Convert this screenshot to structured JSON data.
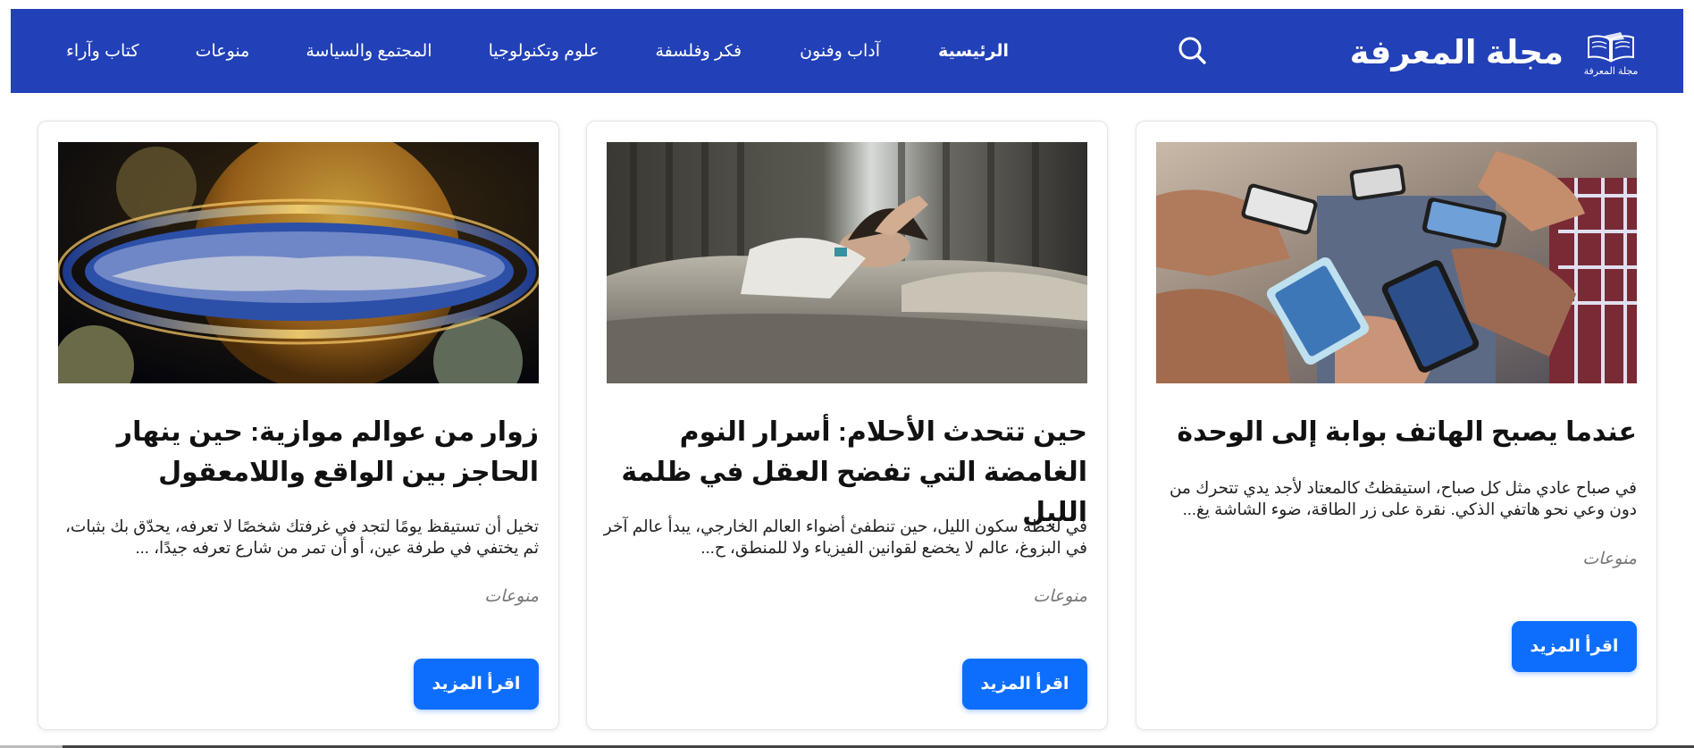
{
  "header": {
    "brand_name": "مجلة المعرفة",
    "logo_caption": "مجلة المعرفة",
    "bg_color": "#2240b7",
    "search_icon": "search-icon",
    "nav": [
      {
        "label": "الرئيسية",
        "active": true
      },
      {
        "label": "آداب وفنون",
        "active": false
      },
      {
        "label": "فكر وفلسفة",
        "active": false
      },
      {
        "label": "علوم وتكنولوجيا",
        "active": false
      },
      {
        "label": "المجتمع والسياسة",
        "active": false
      },
      {
        "label": "منوعات",
        "active": false
      },
      {
        "label": "كتاب وآراء",
        "active": false
      }
    ]
  },
  "articles": [
    {
      "image": "people-holding-phones",
      "title": "عندما يصبح الهاتف بوابة إلى الوحدة",
      "excerpt": "في صباح عادي مثل كل صباح، استيقظتُ كالمعتاد لأجد يدي تتحرك من دون وعي نحو هاتفي الذكي. نقرة على زر الطاقة، ضوء الشاشة يغ...",
      "category": "منوعات",
      "button": "اقرأ المزيد"
    },
    {
      "image": "person-sleeping-in-bed",
      "title": "حين تتحدث الأحلام: أسرار النوم الغامضة التي تفضح العقل في ظلمة الليل",
      "excerpt": "في لحظة سكون الليل، حين تنطفئ أضواء العالم الخارجي، يبدأ عالم آخر في البزوغ، عالم لا يخضع لقوانين الفيزياء ولا للمنطق، ح...",
      "category": "منوعات",
      "button": "اقرأ المزيد"
    },
    {
      "image": "parallel-worlds-planet",
      "title": "زوار من عوالم موازية: حين ينهار الحاجز بين الواقع واللامعقول",
      "excerpt": "تخيل أن تستيقظ يومًا لتجد في غرفتك شخصًا لا تعرفه، يحدّق بك بثبات، ثم يختفي في طرفة عين، أو أن تمر من شارع تعرفه جيدًا، ...",
      "category": "منوعات",
      "button": "اقرأ المزيد"
    }
  ],
  "colors": {
    "accent_button": "#0d6efd",
    "category_text": "#777777"
  }
}
